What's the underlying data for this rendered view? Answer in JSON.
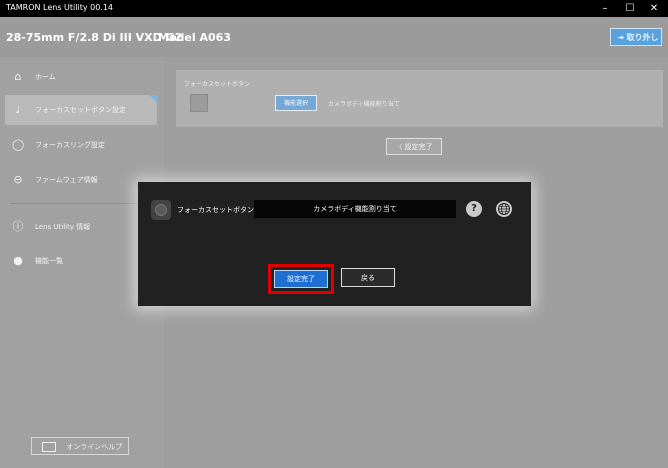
{
  "window": {
    "title": "TAMRON Lens Utility 00.14",
    "minimize": "–",
    "maximize": "☐",
    "close": "✕"
  },
  "header": {
    "model": "28-75mm F/2.8 Di III VXD G2",
    "model_number": "Model A063",
    "detach_label": "取り外し"
  },
  "sidebar": {
    "items": [
      {
        "label": "ホーム",
        "icon": "home-icon",
        "glyph": "⌂"
      },
      {
        "label": "フォーカスセットボタン設定",
        "icon": "focus-set-button-icon",
        "glyph": "♩"
      },
      {
        "label": "フォーカスリング設定",
        "icon": "focus-ring-icon",
        "glyph": "◯"
      },
      {
        "label": "ファームウェア情報",
        "icon": "firmware-icon",
        "glyph": "⊖"
      },
      {
        "label": "Lens Utility 情報",
        "icon": "info-icon",
        "glyph": "ⓘ"
      },
      {
        "label": "機能一覧",
        "icon": "function-list-icon",
        "glyph": "●"
      }
    ],
    "help_label": "オンラインヘルプ"
  },
  "panel": {
    "label": "フォーカスセットボタン",
    "function_select": "機能選択",
    "assignment": "カメラボディ機能割り当て"
  },
  "done_back_label": "設定完了",
  "dialog": {
    "label": "フォーカスセットボタン",
    "value": "カメラボディ機能割り当て",
    "ok_label": "設定完了",
    "back_label": "戻る"
  }
}
